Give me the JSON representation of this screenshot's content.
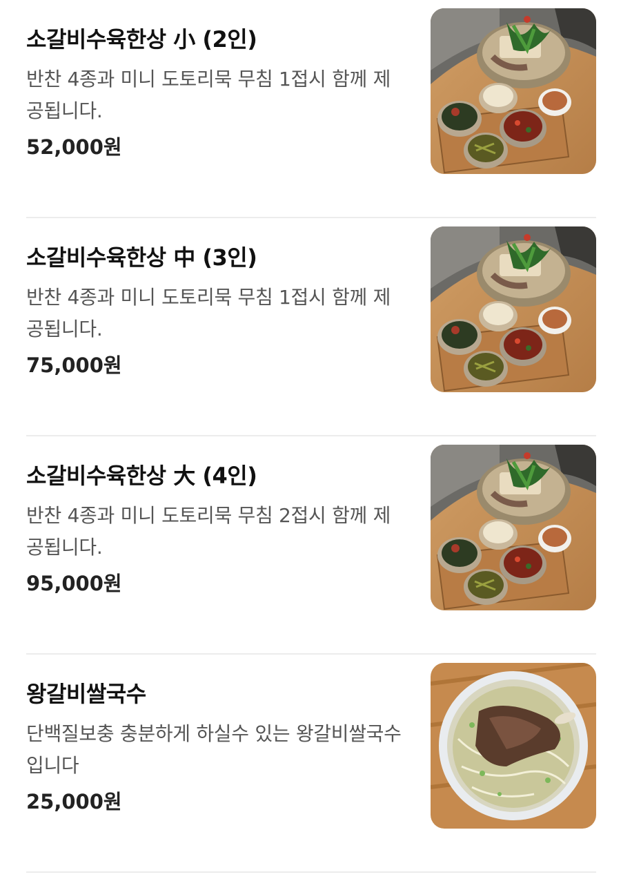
{
  "menu": {
    "items": [
      {
        "name": "소갈비수육한상 小 (2인)",
        "description": "반찬 4종과 미니 도토리묵 무침 1접시 함께 제공됩니다.",
        "price": "52,000원",
        "photo": "beef-rib-set-photo"
      },
      {
        "name": "소갈비수육한상 中 (3인)",
        "description": "반찬 4종과 미니 도토리묵 무침 1접시 함께 제공됩니다.",
        "price": "75,000원",
        "photo": "beef-rib-set-photo"
      },
      {
        "name": "소갈비수육한상 大 (4인)",
        "description": "반찬 4종과 미니 도토리묵 무침 2접시 함께 제공됩니다.",
        "price": "95,000원",
        "photo": "beef-rib-set-photo"
      },
      {
        "name": "왕갈비쌀국수",
        "description": "단백질보충 충분하게 하실수 있는 왕갈비쌀국수 입니다",
        "price": "25,000원",
        "photo": "rib-rice-noodle-photo"
      }
    ]
  }
}
